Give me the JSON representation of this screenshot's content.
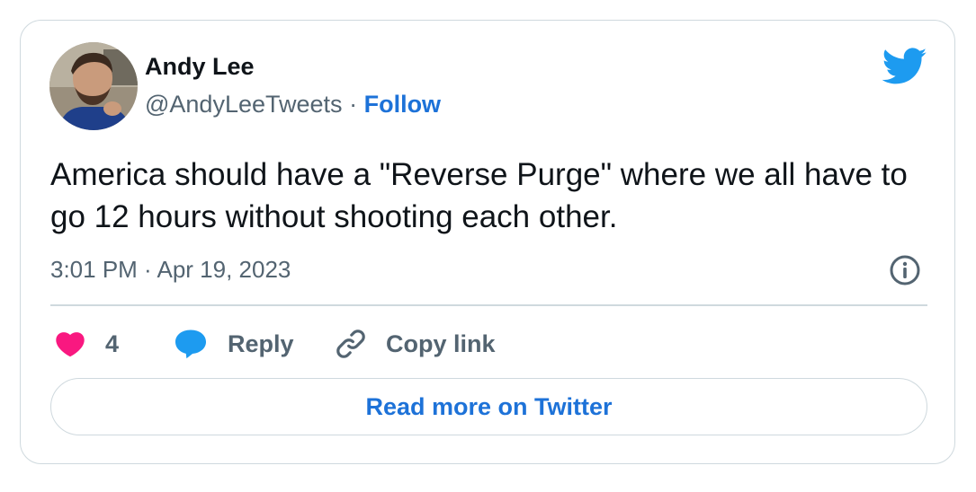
{
  "author": {
    "display_name": "Andy Lee",
    "handle": "@AndyLeeTweets",
    "separator": "·",
    "follow_label": "Follow",
    "avatar_icon": "profile-photo"
  },
  "brand": {
    "logo_icon": "twitter-bird-icon",
    "accent_color": "#1d9bf0",
    "link_color": "#1d72d8"
  },
  "tweet": {
    "text": "America should have a \"Reverse Purge\" where we all have to go 12 hours without shooting each other.",
    "timestamp": "3:01 PM · Apr 19, 2023",
    "info_icon": "info-icon"
  },
  "actions": {
    "like_count": "4",
    "like_icon": "heart-icon",
    "like_color": "#f91880",
    "reply_label": "Reply",
    "reply_icon": "speech-bubble-icon",
    "copy_link_label": "Copy link",
    "copy_link_icon": "link-icon"
  },
  "footer": {
    "read_more_label": "Read more on Twitter"
  }
}
